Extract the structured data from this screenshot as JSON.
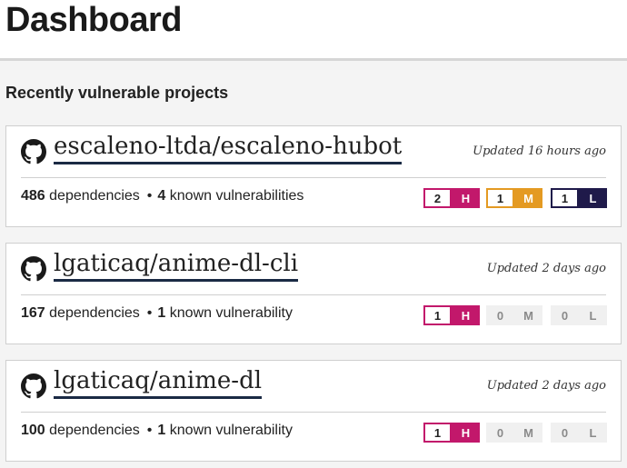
{
  "page": {
    "title": "Dashboard"
  },
  "section": {
    "title": "Recently vulnerable projects"
  },
  "colors": {
    "high": "#c2186b",
    "medium": "#e49a22",
    "low": "#1f1a4a",
    "zero_bg": "#f0f0f0"
  },
  "projects": [
    {
      "name": "escaleno-ltda/escaleno-hubot",
      "updated": "Updated 16 hours ago",
      "dependencies": "486",
      "dependencies_label": "dependencies",
      "vulns": "4",
      "vulns_label": "known vulnerabilities",
      "severity": [
        {
          "count": "2",
          "letter": "H"
        },
        {
          "count": "1",
          "letter": "M"
        },
        {
          "count": "1",
          "letter": "L"
        }
      ]
    },
    {
      "name": "lgaticaq/anime-dl-cli",
      "updated": "Updated 2 days ago",
      "dependencies": "167",
      "dependencies_label": "dependencies",
      "vulns": "1",
      "vulns_label": "known vulnerability",
      "severity": [
        {
          "count": "1",
          "letter": "H"
        },
        {
          "count": "0",
          "letter": "M"
        },
        {
          "count": "0",
          "letter": "L"
        }
      ]
    },
    {
      "name": "lgaticaq/anime-dl",
      "updated": "Updated 2 days ago",
      "dependencies": "100",
      "dependencies_label": "dependencies",
      "vulns": "1",
      "vulns_label": "known vulnerability",
      "severity": [
        {
          "count": "1",
          "letter": "H"
        },
        {
          "count": "0",
          "letter": "M"
        },
        {
          "count": "0",
          "letter": "L"
        }
      ]
    }
  ]
}
